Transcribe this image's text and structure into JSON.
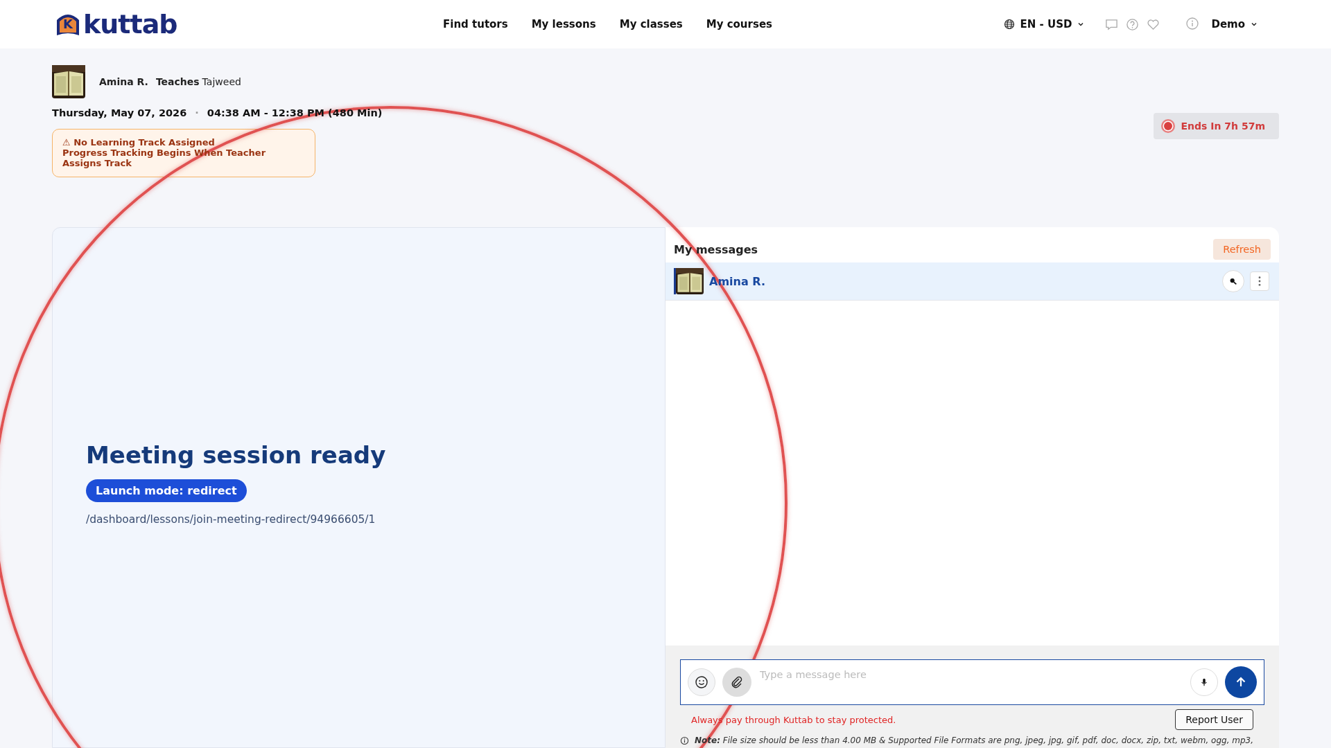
{
  "header": {
    "logo_mark": "K",
    "logo": "kuttab",
    "nav": [
      {
        "label": "Find tutors"
      },
      {
        "label": "My lessons"
      },
      {
        "label": "My classes"
      },
      {
        "label": "My courses"
      }
    ],
    "locale": "EN - USD",
    "user": "Demo"
  },
  "lesson": {
    "teacher": "Amina R.",
    "teaches_label": "Teaches",
    "subject": "Tajweed",
    "date": "Thursday, May 07, 2026",
    "separator": "·",
    "time": "04:38 AM - 12:38 PM (480 Min)",
    "alert": {
      "title": "⚠ No Learning Track Assigned",
      "message": "Progress Tracking Begins When Teacher Assigns Track"
    },
    "countdown": "Ends In 7h 57m"
  },
  "meeting": {
    "title": "Meeting session ready",
    "mode": "Launch mode: redirect",
    "path": "/dashboard/lessons/join-meeting-redirect/94966605/1"
  },
  "messages": {
    "title": "My messages",
    "refresh": "Refresh",
    "contacts": [
      {
        "name": "Amina R.",
        "selected": true
      }
    ],
    "composer": {
      "placeholder": "Type a message here"
    },
    "warning": "Always pay through Kuttab to stay protected.",
    "report": "Report User",
    "note": "**Note:** File size should be less than 4.00 MB & Supported File Formats are png, jpeg, jpg, gif, pdf, doc, docx, zip, txt, webm, ogg, mp3,"
  }
}
